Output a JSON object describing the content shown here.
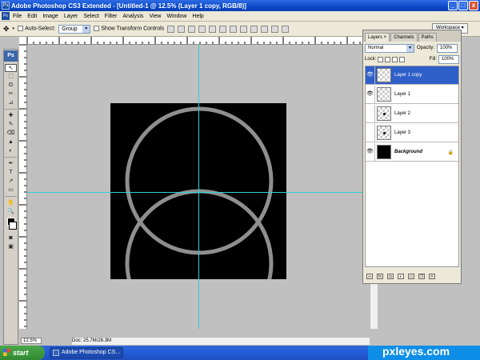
{
  "window": {
    "title": "Adobe Photoshop CS3 Extended - [Untitled-1 @ 12.5% (Layer 1 copy, RGB/8)]",
    "minimize_label": "_",
    "maximize_label": "□",
    "close_label": "x",
    "app_icon_label": "Ps"
  },
  "menu": {
    "items": [
      "File",
      "Edit",
      "Image",
      "Layer",
      "Select",
      "Filter",
      "Analysis",
      "View",
      "Window",
      "Help"
    ]
  },
  "options_bar": {
    "auto_select_label": "Auto-Select:",
    "auto_select_value": "Group",
    "show_transform_label": "Show Transform Controls",
    "workspace_label": "Workspace ▾"
  },
  "toolbox": {
    "logo": "Ps",
    "tools": [
      "↖",
      "⬚",
      "ʘ",
      "✂",
      "⊿",
      "✚",
      "✎",
      "⌫",
      "▲",
      "◐",
      "✒",
      "T",
      "↗",
      "▭",
      "✋",
      "🔍"
    ]
  },
  "layers_panel": {
    "tabs": [
      "Layers ×",
      "Channels",
      "Paths"
    ],
    "blend_mode": "Normal",
    "opacity_label": "Opacity:",
    "opacity_value": "100%",
    "lock_label": "Lock:",
    "fill_label": "Fill:",
    "fill_value": "100%",
    "layers": [
      {
        "name": "Layer 1 copy",
        "visible": true,
        "selected": true,
        "thumb": "transparent"
      },
      {
        "name": "Layer 1",
        "visible": true,
        "selected": false,
        "thumb": "transparent"
      },
      {
        "name": "Layer 2",
        "visible": false,
        "selected": false,
        "thumb": "dot"
      },
      {
        "name": "Layer 3",
        "visible": false,
        "selected": false,
        "thumb": "dot"
      },
      {
        "name": "Background",
        "visible": true,
        "selected": false,
        "thumb": "black",
        "locked": true
      }
    ],
    "footer_icons": [
      "link-icon",
      "fx-icon",
      "mask-icon",
      "adjustment-icon",
      "folder-icon",
      "new-layer-icon",
      "trash-icon"
    ]
  },
  "status": {
    "zoom": "12.5%",
    "doc_info": "Doc: 25.7M/28.3M"
  },
  "taskbar": {
    "start_label": "start",
    "task_label": "Adobe Photoshop CS..."
  },
  "watermark": "pxleyes.com",
  "colors": {
    "canvas": "#000000",
    "ring": "#8f8f8f",
    "guide": "#2fd0d8",
    "selected_layer": "#2f5fc8"
  }
}
